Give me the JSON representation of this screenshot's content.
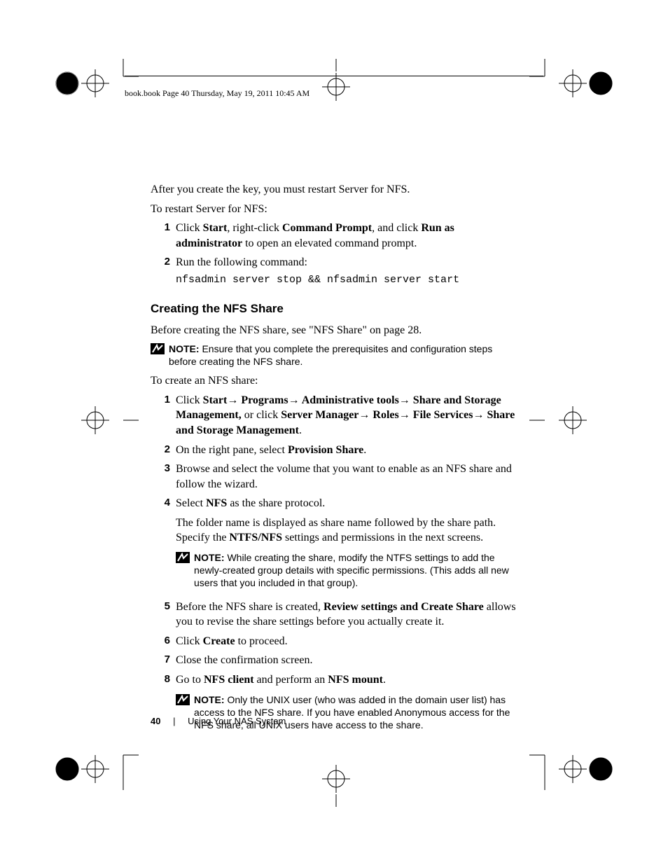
{
  "header": {
    "running": "book.book  Page 40  Thursday, May 19, 2011  10:45 AM"
  },
  "intro": {
    "line1": "After you create the key, you must restart Server for NFS.",
    "line2": "To restart Server for NFS:"
  },
  "restart_steps": [
    {
      "num": "1",
      "pre": "Click ",
      "b1": "Start",
      "mid1": ", right-click ",
      "b2": "Command Prompt",
      "mid2": ", and click ",
      "b3": "Run as administrator",
      "post": " to open an elevated command prompt."
    },
    {
      "num": "2",
      "pre": "Run the following command:",
      "code": "nfsadmin server stop && nfsadmin server start"
    }
  ],
  "section_heading": "Creating the NFS Share",
  "before_line": "Before creating the NFS share, see \"NFS Share\" on page 28.",
  "note1": {
    "label": "NOTE:",
    "text": " Ensure that you complete the prerequisites and configuration steps before creating the NFS share."
  },
  "create_intro": "To create an NFS share:",
  "create_steps": {
    "s1": {
      "num": "1",
      "t1": "Click ",
      "b1": "Start",
      "t2": " Programs",
      "t3": " Administrative tools",
      "t4": " Share and Storage Management,",
      "t5": " or click ",
      "b2": "Server Manager",
      "t6": " Roles",
      "t7": " File Services",
      "t8": " Share and Storage Management",
      "t9": "."
    },
    "s2": {
      "num": "2",
      "t1": "On the right pane, select ",
      "b1": "Provision Share",
      "t2": "."
    },
    "s3": {
      "num": "3",
      "t1": "Browse and select the volume that you want to enable as an NFS share and follow the wizard."
    },
    "s4": {
      "num": "4",
      "t1": "Select ",
      "b1": "NFS",
      "t2": " as the share protocol.",
      "p2a": "The folder name is displayed as share name followed by the share path. Specify the ",
      "p2b": "NTFS/NFS",
      "p2c": " settings and permissions in the next screens."
    },
    "note2": {
      "label": "NOTE:",
      "text": " While creating the share, modify the NTFS settings to add the newly-created group details with specific permissions. (This adds all new users that you included in that group)."
    },
    "s5": {
      "num": "5",
      "t1": "Before the NFS share is created, ",
      "b1": "Review settings and Create Share",
      "t2": " allows you to revise the share settings before you actually create it."
    },
    "s6": {
      "num": "6",
      "t1": "Click ",
      "b1": "Create",
      "t2": " to proceed."
    },
    "s7": {
      "num": "7",
      "t1": "Close the confirmation screen."
    },
    "s8": {
      "num": "8",
      "t1": "Go to ",
      "b1": "NFS client",
      "t2": " and perform an ",
      "b2": "NFS mount",
      "t3": "."
    },
    "note3": {
      "label": "NOTE:",
      "text": " Only the UNIX user (who was added in the domain user list) has access to the NFS share. If you have enabled Anonymous access for the NFS share, all UNIX users have access to the share."
    }
  },
  "footer": {
    "page": "40",
    "section": "Using Your NAS System"
  },
  "glyphs": {
    "arrow": "→"
  }
}
